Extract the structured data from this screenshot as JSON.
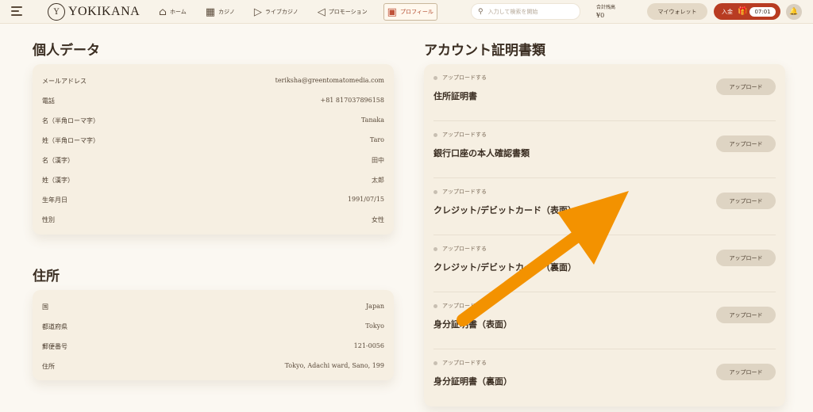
{
  "header": {
    "logo_mark": "Y",
    "logo_text": "YOKIKANA",
    "nav": [
      {
        "label": "ホーム",
        "icon": "home-icon"
      },
      {
        "label": "カジノ",
        "icon": "grid-icon"
      },
      {
        "label": "ライブカジノ",
        "icon": "live-icon"
      },
      {
        "label": "プロモーション",
        "icon": "megaphone-icon"
      },
      {
        "label": "プロフィール",
        "icon": "profile-icon"
      }
    ],
    "search_placeholder": "入力して検索を開始",
    "balance_label": "合計残高",
    "balance_value": "¥0",
    "wallet_label": "マイウォレット",
    "deposit_label": "入金",
    "timer": "07:01"
  },
  "personal": {
    "title": "個人データ",
    "rows": [
      {
        "label": "メールアドレス",
        "value": "teriksha@greentomatomedia.com"
      },
      {
        "label": "電話",
        "value": "+81 817037896158"
      },
      {
        "label": "名（半角ローマ字）",
        "value": "Tanaka"
      },
      {
        "label": "姓（半角ローマ字）",
        "value": "Taro"
      },
      {
        "label": "名（漢字）",
        "value": "田中"
      },
      {
        "label": "姓（漢字）",
        "value": "太郎"
      },
      {
        "label": "生年月日",
        "value": "1991/07/15"
      },
      {
        "label": "性別",
        "value": "女性"
      }
    ]
  },
  "address": {
    "title": "住所",
    "rows": [
      {
        "label": "国",
        "value": "Japan"
      },
      {
        "label": "都道府県",
        "value": "Tokyo"
      },
      {
        "label": "郵便番号",
        "value": "121-0056"
      },
      {
        "label": "住所",
        "value": "Tokyo, Adachi ward, Sano, 199"
      }
    ]
  },
  "documents": {
    "title": "アカウント証明書類",
    "items": [
      {
        "status": "アップロードする",
        "name": "住所証明書",
        "button": "アップロード"
      },
      {
        "status": "アップロードする",
        "name": "銀行口座の本人確認書類",
        "button": "アップロード"
      },
      {
        "status": "アップロードする",
        "name": "クレジット/デビットカード（表面）",
        "button": "アップロード"
      },
      {
        "status": "アップロードする",
        "name": "クレジット/デビットカード（裏面）",
        "button": "アップロード"
      },
      {
        "status": "アップロードする",
        "name": "身分証明書（表面）",
        "button": "アップロード"
      },
      {
        "status": "アップロードする",
        "name": "身分証明書（裏面）",
        "button": "アップロード"
      }
    ]
  },
  "colors": {
    "accent": "#b83c22",
    "arrow": "#f39200",
    "card": "#f6efe2"
  }
}
